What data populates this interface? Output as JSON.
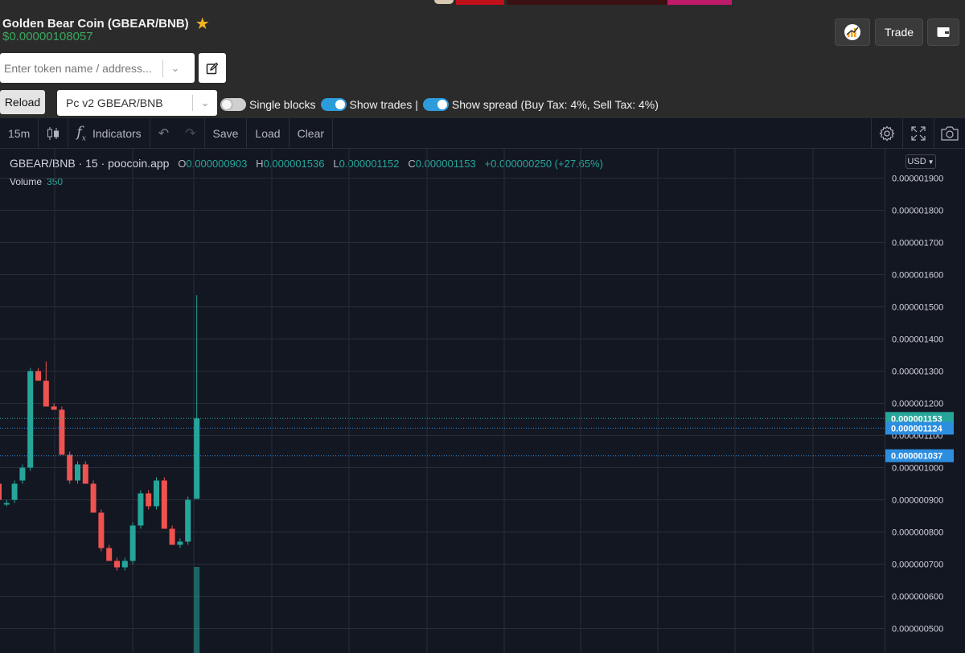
{
  "header": {
    "title": "Golden Bear Coin (GBEAR/BNB)",
    "price": "$0.00000108057",
    "trade_label": "Trade"
  },
  "search": {
    "placeholder": "Enter token name / address..."
  },
  "controls": {
    "reload_label": "Reload",
    "pair_value": "Pc v2 GBEAR/BNB",
    "toggles": [
      {
        "label": "Single blocks",
        "on": false
      },
      {
        "label": "Show trades |",
        "on": true
      },
      {
        "label": "Show spread (Buy Tax: 4%, Sell Tax: 4%)",
        "on": true
      }
    ]
  },
  "toolbar": {
    "interval": "15m",
    "indicators": "Indicators",
    "save": "Save",
    "load": "Load",
    "clear": "Clear"
  },
  "legend": {
    "symbol": "GBEAR/BNB · 15 · poocoin.app",
    "o_label": "O",
    "o": "0.000000903",
    "h_label": "H",
    "h": "0.000001536",
    "l_label": "L",
    "l": "0.000001152",
    "c_label": "C",
    "c": "0.000001153",
    "change": "+0.000000250 (+27.65%)",
    "volume_label": "Volume",
    "volume": "350",
    "currency": "USD"
  },
  "chart_data": {
    "type": "candlestick",
    "title": "GBEAR/BNB · 15 · poocoin.app",
    "ylim": [
      4.5e-07,
      1.95e-06
    ],
    "y_ticks": [
      "0.000001900",
      "0.000001800",
      "0.000001700",
      "0.000001600",
      "0.000001500",
      "0.000001400",
      "0.000001300",
      "0.000001200",
      "0.000001100",
      "0.000001000",
      "0.000000900",
      "0.000000800",
      "0.000000700",
      "0.000000600",
      "0.000000500"
    ],
    "price_labels": [
      {
        "value": "0.000001153",
        "color": "#26a69a"
      },
      {
        "value": "0.000001124",
        "color": "#2d8ee0"
      },
      {
        "value": "0.000001037",
        "color": "#2d8ee0"
      }
    ],
    "candles": [
      {
        "o": 9.5e-07,
        "h": 1.1e-06,
        "l": 8.9e-07,
        "c": 9e-07
      },
      {
        "o": 8.9e-07,
        "h": 9e-07,
        "l": 8.8e-07,
        "c": 8.9e-07
      },
      {
        "o": 9e-07,
        "h": 9.6e-07,
        "l": 8.9e-07,
        "c": 9.5e-07
      },
      {
        "o": 9.6e-07,
        "h": 1.01e-06,
        "l": 9.5e-07,
        "c": 1e-06
      },
      {
        "o": 1e-06,
        "h": 1.31e-06,
        "l": 9.9e-07,
        "c": 1.3e-06
      },
      {
        "o": 1.3e-06,
        "h": 1.31e-06,
        "l": 1.27e-06,
        "c": 1.27e-06
      },
      {
        "o": 1.27e-06,
        "h": 1.33e-06,
        "l": 1.19e-06,
        "c": 1.19e-06
      },
      {
        "o": 1.19e-06,
        "h": 1.2e-06,
        "l": 1.18e-06,
        "c": 1.18e-06
      },
      {
        "o": 1.18e-06,
        "h": 1.19e-06,
        "l": 1.04e-06,
        "c": 1.04e-06
      },
      {
        "o": 1.04e-06,
        "h": 1.05e-06,
        "l": 9.5e-07,
        "c": 9.6e-07
      },
      {
        "o": 9.6e-07,
        "h": 1.02e-06,
        "l": 9.5e-07,
        "c": 1.01e-06
      },
      {
        "o": 1.01e-06,
        "h": 1.02e-06,
        "l": 9.5e-07,
        "c": 9.5e-07
      },
      {
        "o": 9.5e-07,
        "h": 9.6e-07,
        "l": 8.6e-07,
        "c": 8.6e-07
      },
      {
        "o": 8.6e-07,
        "h": 8.7e-07,
        "l": 7.4e-07,
        "c": 7.5e-07
      },
      {
        "o": 7.5e-07,
        "h": 7.6e-07,
        "l": 7.1e-07,
        "c": 7.1e-07
      },
      {
        "o": 7.1e-07,
        "h": 7.2e-07,
        "l": 6.8e-07,
        "c": 6.9e-07
      },
      {
        "o": 6.9e-07,
        "h": 7.2e-07,
        "l": 6.8e-07,
        "c": 7.1e-07
      },
      {
        "o": 7.1e-07,
        "h": 8.3e-07,
        "l": 7e-07,
        "c": 8.2e-07
      },
      {
        "o": 8.2e-07,
        "h": 9.3e-07,
        "l": 8.1e-07,
        "c": 9.2e-07
      },
      {
        "o": 9.2e-07,
        "h": 9.3e-07,
        "l": 8.7e-07,
        "c": 8.8e-07
      },
      {
        "o": 8.8e-07,
        "h": 9.7e-07,
        "l": 8.7e-07,
        "c": 9.6e-07
      },
      {
        "o": 9.6e-07,
        "h": 9.7e-07,
        "l": 8.1e-07,
        "c": 8.1e-07
      },
      {
        "o": 8.1e-07,
        "h": 8.2e-07,
        "l": 7.6e-07,
        "c": 7.6e-07
      },
      {
        "o": 7.6e-07,
        "h": 7.8e-07,
        "l": 7.5e-07,
        "c": 7.7e-07
      },
      {
        "o": 7.7e-07,
        "h": 9.1e-07,
        "l": 7.6e-07,
        "c": 9e-07
      },
      {
        "o": 9.03e-07,
        "h": 1.536e-06,
        "l": 9.03e-07,
        "c": 1.153e-06
      }
    ],
    "volume": [
      0,
      0,
      0,
      0,
      0,
      0,
      0,
      0,
      0,
      0,
      0,
      0,
      0,
      0,
      0,
      0,
      0,
      0,
      0,
      0,
      0,
      0,
      0,
      0,
      0,
      350
    ],
    "colors": {
      "up": "#26a69a",
      "down": "#ef5350",
      "grid": "#2a2e39",
      "text": "#d1d4dc",
      "background": "#131722"
    }
  }
}
